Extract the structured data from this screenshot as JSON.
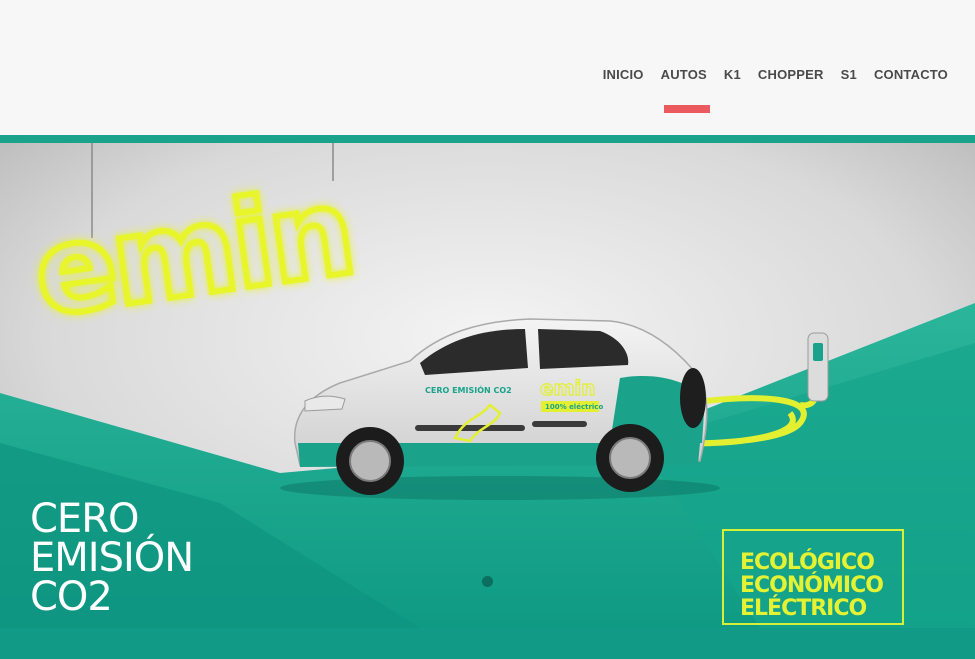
{
  "nav": {
    "items": [
      {
        "label": "INICIO",
        "active": false
      },
      {
        "label": "AUTOS",
        "active": true
      },
      {
        "label": "K1",
        "active": false
      },
      {
        "label": "CHOPPER",
        "active": false
      },
      {
        "label": "S1",
        "active": false
      },
      {
        "label": "CONTACTO",
        "active": false
      }
    ]
  },
  "hero": {
    "logo": "emin",
    "car_decal": {
      "line1": "CERO EMISIÓN CO2",
      "brand": "emin",
      "badge": "100% eléctrico"
    },
    "headline": [
      "CERO",
      "EMISIÓN",
      "CO2"
    ],
    "tagline": [
      "ECOLÓGICO",
      "ECONÓMICO",
      "ELÉCTRICO"
    ],
    "slider": {
      "slides": 1,
      "active": 1
    }
  },
  "colors": {
    "accent_red": "#ea5a5f",
    "teal": "#1aa38a",
    "neon_yellow": "#e4f233",
    "nav_text": "#4a4a4a"
  }
}
